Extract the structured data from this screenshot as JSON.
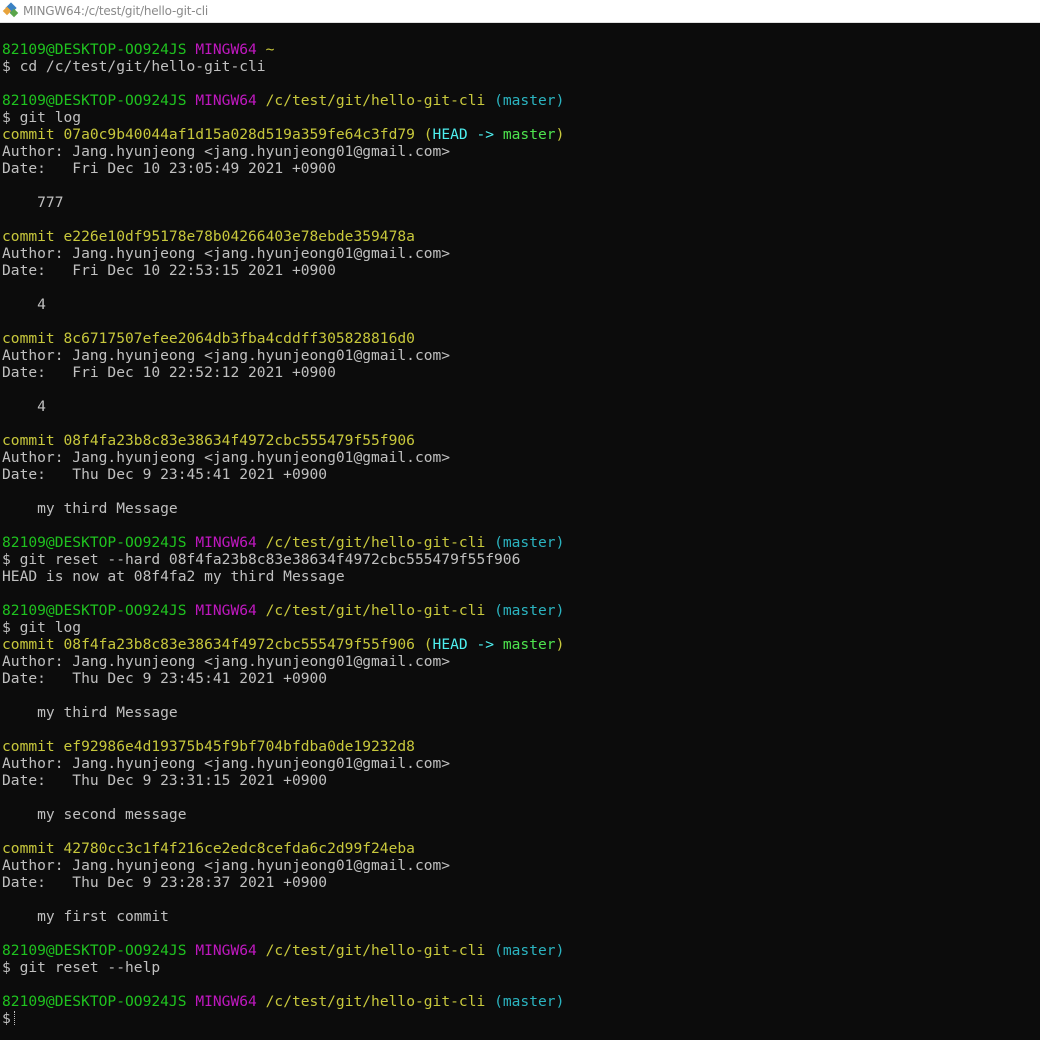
{
  "window": {
    "title": "MINGW64:/c/test/git/hello-git-cli"
  },
  "colors": {
    "user_host": "#1fc31f",
    "shell_name": "#c018c0",
    "path": "#c8c83c",
    "branch": "#2bb4c0",
    "commit": "#c8c83c",
    "head_ref": "#4ef0f0",
    "branch_ref": "#4ee44e",
    "text": "#c0c0c0",
    "background": "#0c0c0c"
  },
  "terminal": {
    "prompt_user": "82109@DESKTOP-OO924JS",
    "prompt_shell": "MINGW64",
    "lines": [
      {
        "type": "prompt",
        "path": "~",
        "branch": ""
      },
      {
        "type": "command",
        "text": "$ cd /c/test/git/hello-git-cli"
      },
      {
        "type": "blank"
      },
      {
        "type": "prompt",
        "path": "/c/test/git/hello-git-cli",
        "branch": "(master)"
      },
      {
        "type": "command",
        "text": "$ git log"
      },
      {
        "type": "commit",
        "text": "commit 07a0c9b40044af1d15a028d519a359fe64c3fd79",
        "head": true
      },
      {
        "type": "text",
        "text": "Author: Jang.hyunjeong <jang.hyunjeong01@gmail.com>"
      },
      {
        "type": "text",
        "text": "Date:   Fri Dec 10 23:05:49 2021 +0900"
      },
      {
        "type": "blank"
      },
      {
        "type": "text",
        "text": "    777"
      },
      {
        "type": "blank"
      },
      {
        "type": "commit",
        "text": "commit e226e10df95178e78b04266403e78ebde359478a",
        "head": false
      },
      {
        "type": "text",
        "text": "Author: Jang.hyunjeong <jang.hyunjeong01@gmail.com>"
      },
      {
        "type": "text",
        "text": "Date:   Fri Dec 10 22:53:15 2021 +0900"
      },
      {
        "type": "blank"
      },
      {
        "type": "text",
        "text": "    4"
      },
      {
        "type": "blank"
      },
      {
        "type": "commit",
        "text": "commit 8c6717507efee2064db3fba4cddff305828816d0",
        "head": false
      },
      {
        "type": "text",
        "text": "Author: Jang.hyunjeong <jang.hyunjeong01@gmail.com>"
      },
      {
        "type": "text",
        "text": "Date:   Fri Dec 10 22:52:12 2021 +0900"
      },
      {
        "type": "blank"
      },
      {
        "type": "text",
        "text": "    4"
      },
      {
        "type": "blank"
      },
      {
        "type": "commit",
        "text": "commit 08f4fa23b8c83e38634f4972cbc555479f55f906",
        "head": false
      },
      {
        "type": "text",
        "text": "Author: Jang.hyunjeong <jang.hyunjeong01@gmail.com>"
      },
      {
        "type": "text",
        "text": "Date:   Thu Dec 9 23:45:41 2021 +0900"
      },
      {
        "type": "blank"
      },
      {
        "type": "text",
        "text": "    my third Message"
      },
      {
        "type": "blank"
      },
      {
        "type": "prompt",
        "path": "/c/test/git/hello-git-cli",
        "branch": "(master)"
      },
      {
        "type": "command",
        "text": "$ git reset --hard 08f4fa23b8c83e38634f4972cbc555479f55f906"
      },
      {
        "type": "text",
        "text": "HEAD is now at 08f4fa2 my third Message"
      },
      {
        "type": "blank"
      },
      {
        "type": "prompt",
        "path": "/c/test/git/hello-git-cli",
        "branch": "(master)"
      },
      {
        "type": "command",
        "text": "$ git log"
      },
      {
        "type": "commit",
        "text": "commit 08f4fa23b8c83e38634f4972cbc555479f55f906",
        "head": true
      },
      {
        "type": "text",
        "text": "Author: Jang.hyunjeong <jang.hyunjeong01@gmail.com>"
      },
      {
        "type": "text",
        "text": "Date:   Thu Dec 9 23:45:41 2021 +0900"
      },
      {
        "type": "blank"
      },
      {
        "type": "text",
        "text": "    my third Message"
      },
      {
        "type": "blank"
      },
      {
        "type": "commit",
        "text": "commit ef92986e4d19375b45f9bf704bfdba0de19232d8",
        "head": false
      },
      {
        "type": "text",
        "text": "Author: Jang.hyunjeong <jang.hyunjeong01@gmail.com>"
      },
      {
        "type": "text",
        "text": "Date:   Thu Dec 9 23:31:15 2021 +0900"
      },
      {
        "type": "blank"
      },
      {
        "type": "text",
        "text": "    my second message"
      },
      {
        "type": "blank"
      },
      {
        "type": "commit",
        "text": "commit 42780cc3c1f4f216ce2edc8cefda6c2d99f24eba",
        "head": false
      },
      {
        "type": "text",
        "text": "Author: Jang.hyunjeong <jang.hyunjeong01@gmail.com>"
      },
      {
        "type": "text",
        "text": "Date:   Thu Dec 9 23:28:37 2021 +0900"
      },
      {
        "type": "blank"
      },
      {
        "type": "text",
        "text": "    my first commit"
      },
      {
        "type": "blank"
      },
      {
        "type": "prompt",
        "path": "/c/test/git/hello-git-cli",
        "branch": "(master)"
      },
      {
        "type": "command",
        "text": "$ git reset --help"
      },
      {
        "type": "blank"
      },
      {
        "type": "prompt",
        "path": "/c/test/git/hello-git-cli",
        "branch": "(master)"
      },
      {
        "type": "input",
        "text": "$"
      }
    ],
    "head_ref": {
      "open": "(",
      "head": "HEAD -> ",
      "branch": "master",
      "close": ")"
    }
  }
}
